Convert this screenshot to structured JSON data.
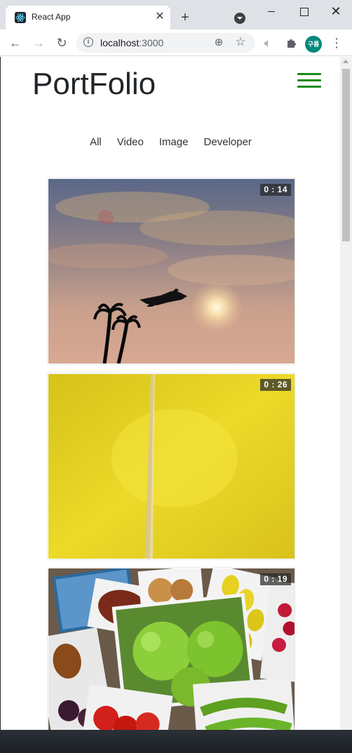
{
  "browser": {
    "tab_title": "React App",
    "tab_close": "✕",
    "new_tab": "+",
    "url_host": "localhost",
    "url_port": ":3000",
    "profile_label": "구름",
    "icons": [
      "react-favicon-icon",
      "back-arrow-icon",
      "forward-arrow-icon",
      "reload-icon",
      "info-icon",
      "zoom-icon",
      "star-icon",
      "speaker-icon",
      "puzzle-icon",
      "kebab-menu-icon"
    ]
  },
  "site": {
    "title": "PortFolio",
    "menu_color": "#1a8a1a"
  },
  "filters": [
    "All",
    "Video",
    "Image",
    "Developer"
  ],
  "videos": [
    {
      "duration": "0 : 14",
      "scene": "sunset sky with airplane and palm trees"
    },
    {
      "duration": "0 : 26",
      "scene": "yellow rapeseed field with path"
    },
    {
      "duration": "0 : 19",
      "scene": "collage of fruits and vegetables"
    }
  ]
}
